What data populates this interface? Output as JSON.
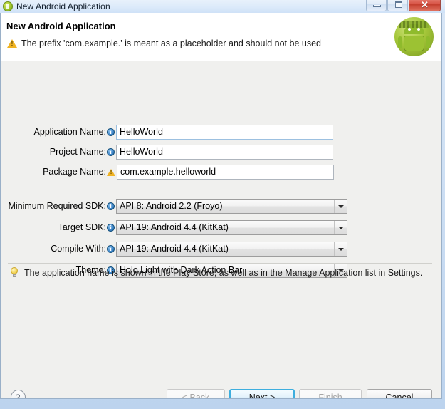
{
  "window": {
    "title": "New Android Application",
    "app_icon": "android-icon",
    "controls": {
      "minimize": "minimize-icon",
      "maximize": "maximize-icon",
      "close": "✕"
    }
  },
  "header": {
    "title": "New Android Application",
    "warning_icon": "warning-triangle-icon",
    "message": "The prefix 'com.example.' is meant as a placeholder and should not be used",
    "logo": "android-robot-icon"
  },
  "form": {
    "fields": [
      {
        "label": "Application Name:",
        "badge": "info",
        "badge_icon": "info-icon",
        "type": "text",
        "value": "HelloWorld",
        "placeholder": "",
        "focused": true
      },
      {
        "label": "Project Name:",
        "badge": "info",
        "badge_icon": "info-icon",
        "type": "text",
        "value": "HelloWorld",
        "placeholder": "",
        "focused": false
      },
      {
        "label": "Package Name:",
        "badge": "warn",
        "badge_icon": "warning-triangle-icon",
        "type": "text",
        "value": "com.example.helloworld",
        "placeholder": "",
        "focused": false
      },
      {
        "label": "Minimum Required SDK:",
        "badge": "info",
        "badge_icon": "info-icon",
        "type": "combo",
        "value": "API 8: Android 2.2 (Froyo)"
      },
      {
        "label": "Target SDK:",
        "badge": "info",
        "badge_icon": "info-icon",
        "type": "combo",
        "value": "API 19: Android 4.4 (KitKat)"
      },
      {
        "label": "Compile With:",
        "badge": "info",
        "badge_icon": "info-icon",
        "type": "combo",
        "value": "API 19: Android 4.4 (KitKat)"
      },
      {
        "label": "Theme:",
        "badge": "info",
        "badge_icon": "info-icon",
        "type": "combo",
        "value": "Holo Light with Dark Action Bar"
      }
    ]
  },
  "hint": {
    "icon": "lightbulb-icon",
    "text": "The application name is shown in the Play Store, as well as in the Manage Application list in Settings."
  },
  "buttons": {
    "help": "?",
    "back": "< Back",
    "next": "Next >",
    "finish": "Finish",
    "cancel": "Cancel"
  },
  "colors": {
    "accent": "#3eaede",
    "android_green": "#a4c639",
    "warning": "#f0b323",
    "info_blue": "#3f86c8",
    "dialog_bg": "#f0f0ee"
  }
}
